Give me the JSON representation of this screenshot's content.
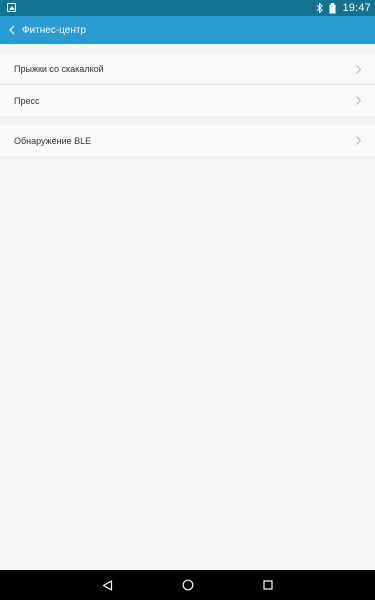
{
  "status_bar": {
    "time": "19:47",
    "icons": [
      "image-notification-icon",
      "bluetooth-icon",
      "battery-icon"
    ]
  },
  "app_bar": {
    "title": "Фитнес-центр",
    "back_icon": "chevron-left-icon"
  },
  "list_groups": [
    {
      "items": [
        {
          "label": "Прыжки со скакалкой"
        },
        {
          "label": "Пресс"
        }
      ]
    },
    {
      "items": [
        {
          "label": "Обнаружение BLE"
        }
      ]
    }
  ],
  "navigation_bar": {
    "buttons": [
      "back-triangle-icon",
      "home-circle-icon",
      "recents-square-icon"
    ]
  },
  "colors": {
    "status_bar": "#14718f",
    "app_bar": "#2a9bd1",
    "background": "#f4f4f4",
    "list_background": "#fafafa",
    "nav_bar": "#000000"
  }
}
